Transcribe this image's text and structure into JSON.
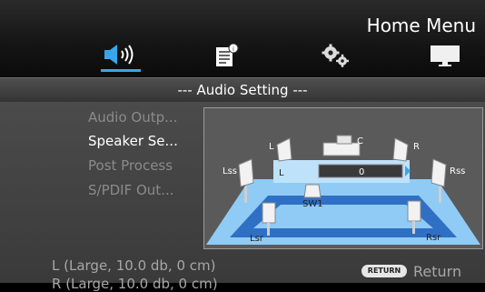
{
  "header": {
    "title": "Home Menu",
    "tabs": [
      {
        "name": "audio-tab",
        "icon": "speaker-icon",
        "active": true
      },
      {
        "name": "disc-info-tab",
        "icon": "document-icon",
        "active": false
      },
      {
        "name": "settings-tab",
        "icon": "gears-icon",
        "active": false
      },
      {
        "name": "display-tab",
        "icon": "monitor-icon",
        "active": false
      }
    ]
  },
  "section_title": "--- Audio Setting ---",
  "menu": {
    "items": [
      {
        "label": "Audio Outp...",
        "active": false
      },
      {
        "label": "Speaker Se...",
        "active": true
      },
      {
        "label": "Post Process",
        "active": false
      },
      {
        "label": "S/PDIF Out...",
        "active": false
      }
    ]
  },
  "speaker_diagram": {
    "labels": {
      "L": "L",
      "C": "C",
      "R": "R",
      "Lss": "Lss",
      "Rss": "Rss",
      "SW1": "SW1",
      "Lsr": "Lsr",
      "Rsr": "Rsr"
    },
    "selected_channel": "L",
    "selected_value": "0"
  },
  "footer": {
    "info_line1": "L (Large, 10.0 db, 0 cm)",
    "info_line2": "R (Large, 10.0 db, 0 cm)",
    "return_badge": "RETURN",
    "return_label": "Return"
  },
  "colors": {
    "accent": "#38a6ea",
    "floor": "#8fcbf5",
    "floor_inner": "#2f6fc4",
    "highlight": "#bfe2fb"
  }
}
